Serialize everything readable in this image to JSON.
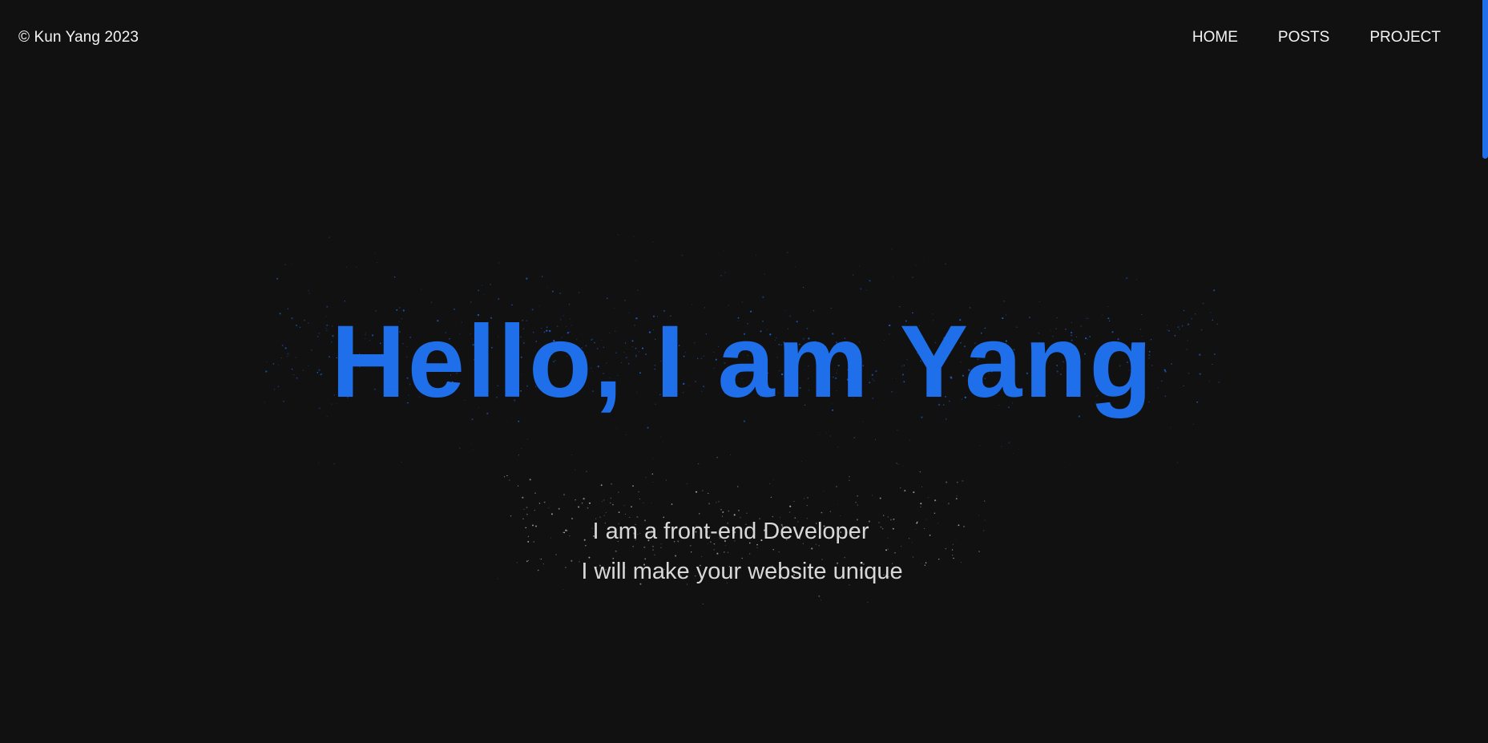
{
  "header": {
    "copyright": "© Kun Yang 2023",
    "nav": [
      {
        "label": "HOME"
      },
      {
        "label": "POSTS"
      },
      {
        "label": "PROJECT"
      }
    ]
  },
  "hero": {
    "title": "Hello, I am Yang",
    "subtitle_line1": "I am a front-end Developer",
    "subtitle_line2": "I will make your website unique"
  },
  "colors": {
    "background": "#111111",
    "accent": "#1f6feb",
    "text": "#f3f3f3"
  }
}
